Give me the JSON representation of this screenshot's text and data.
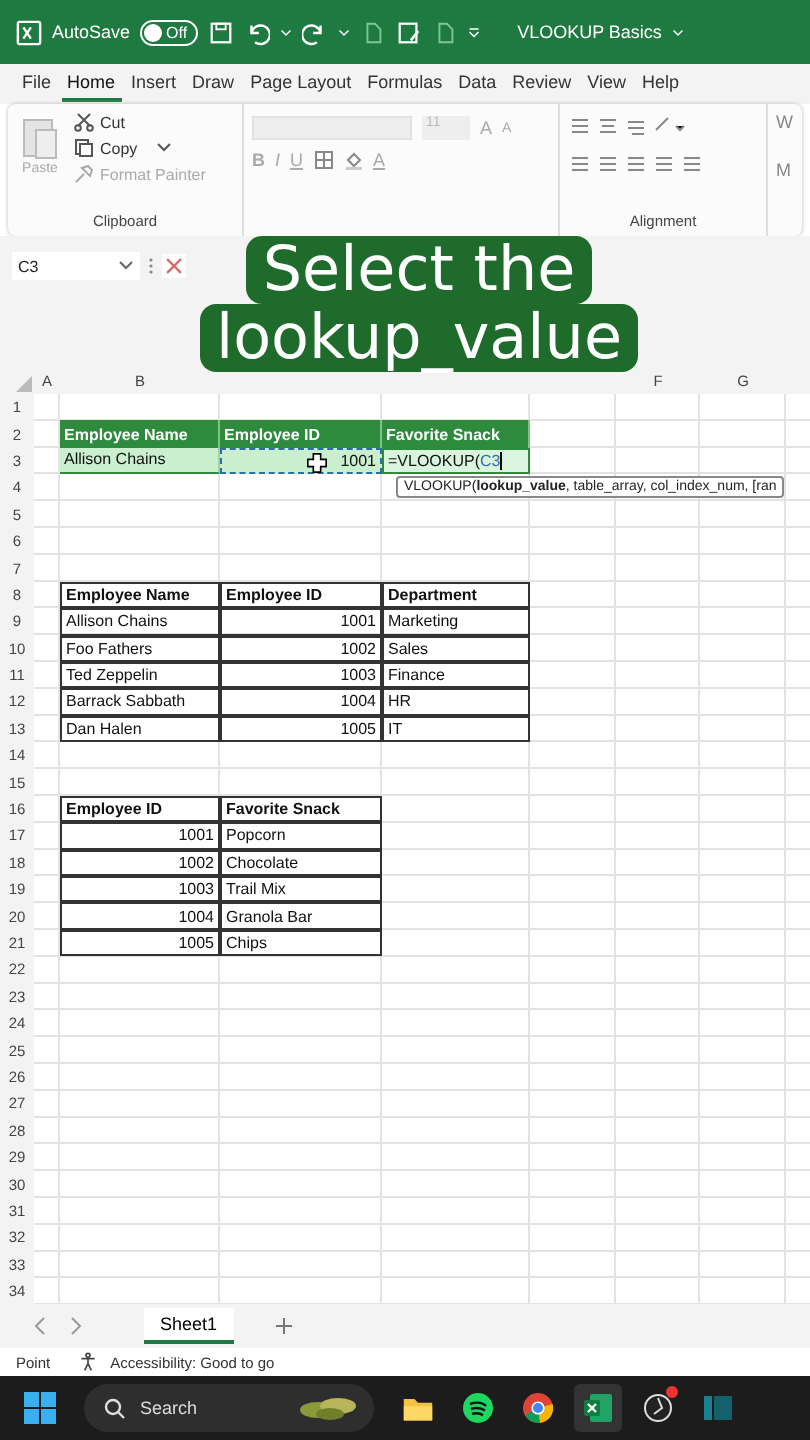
{
  "title_bar": {
    "autosave_label": "AutoSave",
    "autosave": {
      "label": "Off",
      "on": false
    },
    "title": "VLOOKUP Basics"
  },
  "menu_tabs": [
    {
      "label": "File",
      "selected": false
    },
    {
      "label": "Home",
      "selected": true
    },
    {
      "label": "Insert",
      "selected": false
    },
    {
      "label": "Draw",
      "selected": false
    },
    {
      "label": "Page Layout",
      "selected": false
    },
    {
      "label": "Formulas",
      "selected": false
    },
    {
      "label": "Data",
      "selected": false
    },
    {
      "label": "Review",
      "selected": false
    },
    {
      "label": "View",
      "selected": false
    },
    {
      "label": "Help",
      "selected": false
    }
  ],
  "ribbon": {
    "clipboard": {
      "paste": {
        "label": "Paste",
        "disabled": true
      },
      "cut": {
        "label": "Cut",
        "disabled": false
      },
      "copy": {
        "label": "Copy",
        "disabled": false
      },
      "format_painter": {
        "label": "Format Painter",
        "disabled": true
      },
      "group_label": "Clipboard"
    },
    "font": {
      "size": "11",
      "disabled": true,
      "grow": "A",
      "shrink": "A",
      "bold": "B",
      "italic": "I",
      "underline": "U",
      "font_color": "A"
    },
    "alignment": {
      "group_label": "Alignment",
      "wrap_text": "W",
      "merge": "M"
    }
  },
  "formula_bar": {
    "name_box": "C3"
  },
  "caption": [
    "Select the",
    "lookup_value"
  ],
  "column_headers": [
    "A",
    "B",
    "F",
    "G"
  ],
  "rows": [
    {
      "number": "1"
    },
    {
      "number": "2",
      "kind": "green-header",
      "cells": [
        {
          "text": "Employee Name",
          "kind": "text"
        },
        {
          "text": "Employee ID",
          "kind": "text"
        },
        {
          "text": "Favorite Snack",
          "kind": "text"
        }
      ]
    },
    {
      "number": "3",
      "kind": "green-data",
      "cells": [
        {
          "text": "Allison Chains",
          "kind": "text"
        },
        {
          "text": "1001",
          "kind": "number",
          "referenced": true
        },
        {
          "text": "=VLOOKUP(",
          "kind": "formula",
          "reference": "C3"
        }
      ]
    },
    {
      "number": "4"
    },
    {
      "number": "5"
    },
    {
      "number": "6"
    },
    {
      "number": "7"
    },
    {
      "number": "8",
      "kind": "header",
      "cells": [
        {
          "text": "Employee Name",
          "kind": "text"
        },
        {
          "text": "Employee ID",
          "kind": "text"
        },
        {
          "text": "Department",
          "kind": "text"
        }
      ]
    },
    {
      "number": "9",
      "kind": "data",
      "cells": [
        {
          "text": "Allison Chains",
          "kind": "text"
        },
        {
          "text": "1001",
          "kind": "number"
        },
        {
          "text": "Marketing",
          "kind": "text"
        }
      ]
    },
    {
      "number": "10",
      "kind": "data",
      "cells": [
        {
          "text": "Foo Fathers",
          "kind": "text"
        },
        {
          "text": "1002",
          "kind": "number"
        },
        {
          "text": "Sales",
          "kind": "text"
        }
      ]
    },
    {
      "number": "11",
      "kind": "data",
      "cells": [
        {
          "text": "Ted Zeppelin",
          "kind": "text"
        },
        {
          "text": "1003",
          "kind": "number"
        },
        {
          "text": "Finance",
          "kind": "text"
        }
      ]
    },
    {
      "number": "12",
      "kind": "data",
      "cells": [
        {
          "text": "Barrack Sabbath",
          "kind": "text"
        },
        {
          "text": "1004",
          "kind": "number"
        },
        {
          "text": "HR",
          "kind": "text"
        }
      ]
    },
    {
      "number": "13",
      "kind": "data",
      "cells": [
        {
          "text": "Dan Halen",
          "kind": "text"
        },
        {
          "text": "1005",
          "kind": "number"
        },
        {
          "text": "IT",
          "kind": "text"
        }
      ]
    },
    {
      "number": "14"
    },
    {
      "number": "15"
    },
    {
      "number": "16",
      "kind": "header",
      "cells": [
        {
          "text": "Employee ID",
          "kind": "text"
        },
        {
          "text": "Favorite Snack",
          "kind": "text"
        }
      ]
    },
    {
      "number": "17",
      "kind": "data",
      "cells": [
        {
          "text": "1001",
          "kind": "number"
        },
        {
          "text": "Popcorn",
          "kind": "text"
        }
      ]
    },
    {
      "number": "18",
      "kind": "data",
      "cells": [
        {
          "text": "1002",
          "kind": "number"
        },
        {
          "text": "Chocolate",
          "kind": "text"
        }
      ]
    },
    {
      "number": "19",
      "kind": "data",
      "cells": [
        {
          "text": "1003",
          "kind": "number"
        },
        {
          "text": "Trail Mix",
          "kind": "text"
        }
      ]
    },
    {
      "number": "20",
      "kind": "data",
      "cells": [
        {
          "text": "1004",
          "kind": "number"
        },
        {
          "text": "Granola Bar",
          "kind": "text"
        }
      ]
    },
    {
      "number": "21",
      "kind": "data",
      "cells": [
        {
          "text": "1005",
          "kind": "number"
        },
        {
          "text": "Chips",
          "kind": "text"
        }
      ]
    },
    {
      "number": "22"
    },
    {
      "number": "23"
    },
    {
      "number": "24"
    },
    {
      "number": "25"
    },
    {
      "number": "26"
    },
    {
      "number": "27"
    },
    {
      "number": "28"
    },
    {
      "number": "29"
    },
    {
      "number": "30"
    },
    {
      "number": "31"
    },
    {
      "number": "32"
    },
    {
      "number": "33"
    },
    {
      "number": "34"
    }
  ],
  "tooltip": "VLOOKUP(**lookup_value**, table_array, col_index_num, [ran",
  "sheet_tabs": [
    {
      "label": "Sheet1",
      "selected": true
    }
  ],
  "status_bar": {
    "mode": "Point",
    "accessibility": "Accessibility: Good to go"
  },
  "taskbar": {
    "search": {
      "placeholder": "Search"
    }
  }
}
